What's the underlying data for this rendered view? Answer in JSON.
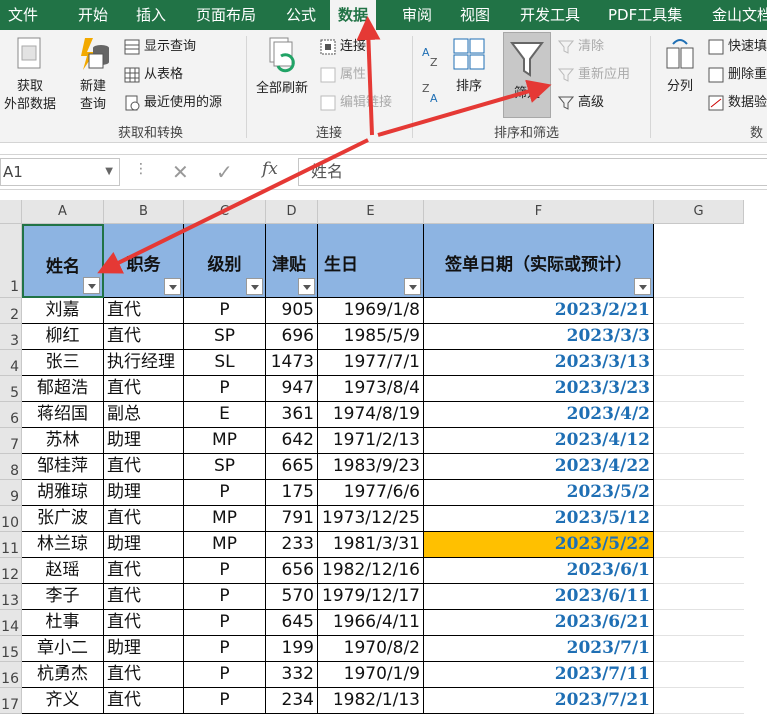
{
  "tabs": [
    "文件",
    "开始",
    "插入",
    "页面布局",
    "公式",
    "数据",
    "审阅",
    "视图",
    "开发工具",
    "PDF工具集",
    "金山文档"
  ],
  "ribbon": {
    "get_data_label": "获取\n外部数据",
    "new_query_label": "新建\n查询",
    "show_queries": "显示查询",
    "from_table": "从表格",
    "recent_sources": "最近使用的源",
    "group_get_transform": "获取和转换",
    "refresh_all": "全部刷新",
    "connections": "连接",
    "properties": "属性",
    "edit_links": "编辑链接",
    "group_connections": "连接",
    "sort": "排序",
    "filter": "筛选",
    "clear": "清除",
    "reapply": "重新应用",
    "advanced": "高级",
    "group_sort_filter": "排序和筛选",
    "split": "分列",
    "flash_fill": "快速填",
    "remove_dup": "删除重",
    "data_valid": "数据验",
    "group_data_tools": "数"
  },
  "formula_bar": {
    "name_box": "A1",
    "formula": "姓名"
  },
  "columns": [
    "A",
    "B",
    "C",
    "D",
    "E",
    "F",
    "G"
  ],
  "headers": {
    "name": "姓名",
    "role": "职务",
    "level": "级别",
    "allowance": "津贴",
    "birthday": "生日",
    "sign_date": "签单日期（实际或预计）"
  },
  "rows": [
    {
      "num": "2",
      "name": "刘嘉",
      "role": "直代",
      "level": "P",
      "allowance": "905",
      "birthday": "1969/1/8",
      "sign_date": "2023/2/21"
    },
    {
      "num": "3",
      "name": "柳红",
      "role": "直代",
      "level": "SP",
      "allowance": "696",
      "birthday": "1985/5/9",
      "sign_date": "2023/3/3"
    },
    {
      "num": "4",
      "name": "张三",
      "role": "执行经理",
      "level": "SL",
      "allowance": "1473",
      "birthday": "1977/7/1",
      "sign_date": "2023/3/13"
    },
    {
      "num": "5",
      "name": "郁超浩",
      "role": "直代",
      "level": "P",
      "allowance": "947",
      "birthday": "1973/8/4",
      "sign_date": "2023/3/23"
    },
    {
      "num": "6",
      "name": "蒋绍国",
      "role": "副总",
      "level": "E",
      "allowance": "361",
      "birthday": "1974/8/19",
      "sign_date": "2023/4/2"
    },
    {
      "num": "7",
      "name": "苏林",
      "role": "助理",
      "level": "MP",
      "allowance": "642",
      "birthday": "1971/2/13",
      "sign_date": "2023/4/12"
    },
    {
      "num": "8",
      "name": "邹桂萍",
      "role": "直代",
      "level": "SP",
      "allowance": "665",
      "birthday": "1983/9/23",
      "sign_date": "2023/4/22"
    },
    {
      "num": "9",
      "name": "胡雅琼",
      "role": "助理",
      "level": "P",
      "allowance": "175",
      "birthday": "1977/6/6",
      "sign_date": "2023/5/2"
    },
    {
      "num": "10",
      "name": "张广波",
      "role": "直代",
      "level": "MP",
      "allowance": "791",
      "birthday": "1973/12/25",
      "sign_date": "2023/5/12"
    },
    {
      "num": "11",
      "name": "林兰琼",
      "role": "助理",
      "level": "MP",
      "allowance": "233",
      "birthday": "1981/3/31",
      "sign_date": "2023/5/22",
      "highlight": "#ffc000"
    },
    {
      "num": "12",
      "name": "赵瑶",
      "role": "直代",
      "level": "P",
      "allowance": "656",
      "birthday": "1982/12/16",
      "sign_date": "2023/6/1"
    },
    {
      "num": "13",
      "name": "李子",
      "role": "直代",
      "level": "P",
      "allowance": "570",
      "birthday": "1979/12/17",
      "sign_date": "2023/6/11"
    },
    {
      "num": "14",
      "name": "杜事",
      "role": "直代",
      "level": "P",
      "allowance": "645",
      "birthday": "1966/4/11",
      "sign_date": "2023/6/21"
    },
    {
      "num": "15",
      "name": "章小二",
      "role": "助理",
      "level": "P",
      "allowance": "199",
      "birthday": "1970/8/2",
      "sign_date": "2023/7/1"
    },
    {
      "num": "16",
      "name": "杭勇杰",
      "role": "直代",
      "level": "P",
      "allowance": "332",
      "birthday": "1970/1/9",
      "sign_date": "2023/7/11"
    },
    {
      "num": "17",
      "name": "齐义",
      "role": "直代",
      "level": "P",
      "allowance": "234",
      "birthday": "1982/1/13",
      "sign_date": "2023/7/21"
    }
  ],
  "colors": {
    "ribbon_green": "#217346",
    "header_fill": "#8db4e2",
    "date_blue": "#1f6fb4",
    "arrow_red": "#e53935",
    "highlight": "#ffc000"
  }
}
